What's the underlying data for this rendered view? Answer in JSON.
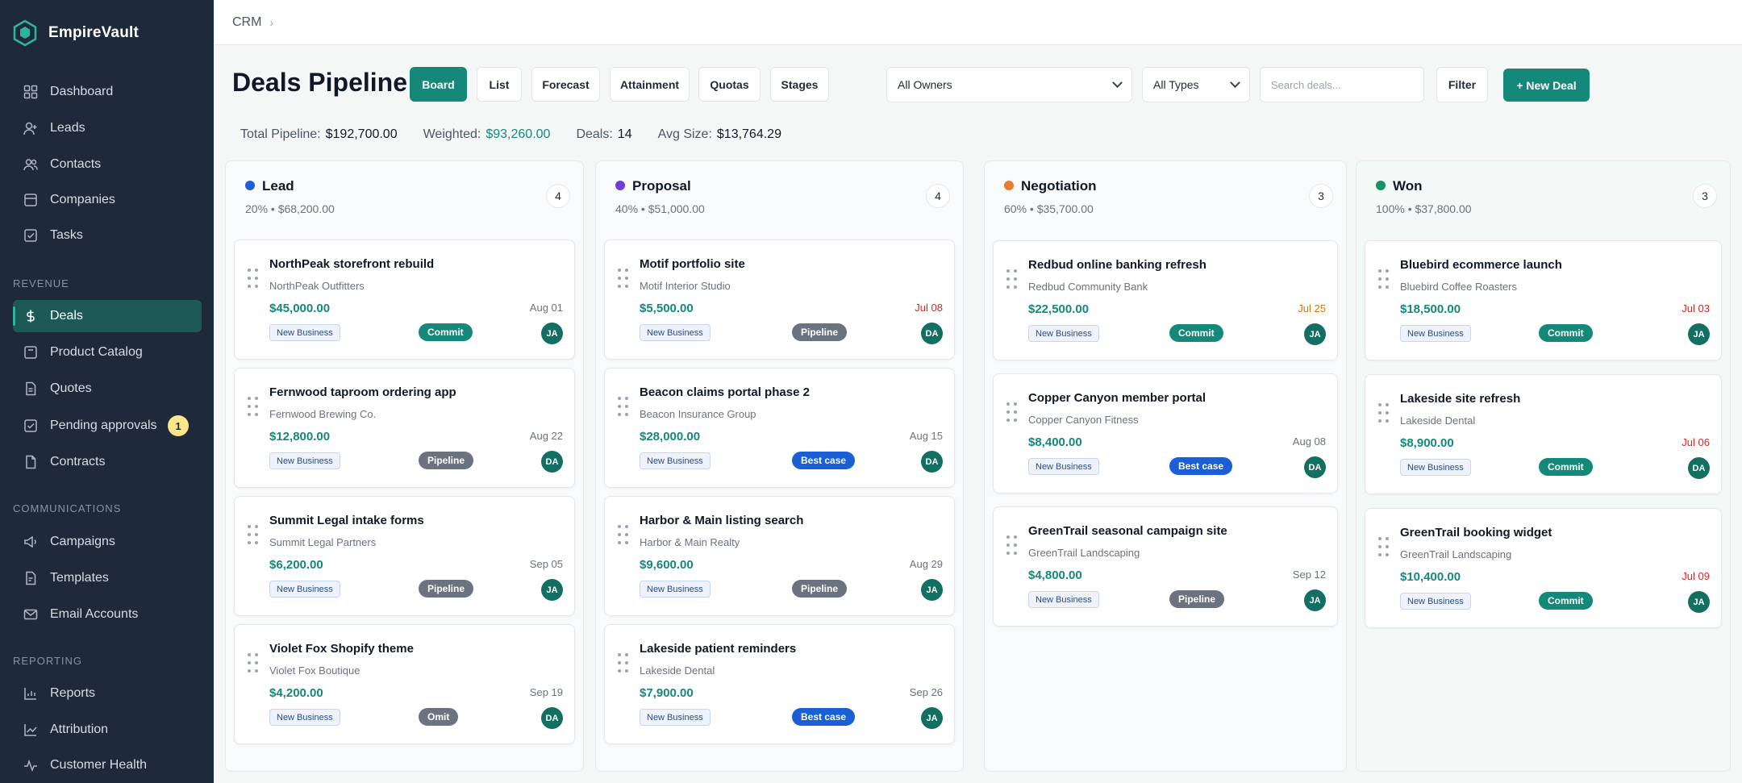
{
  "brand": {
    "name": "EmpireVault"
  },
  "breadcrumb": {
    "root": "CRM",
    "sep": "›"
  },
  "sidebar": {
    "items_main": [
      {
        "label": "Dashboard",
        "icon": "grid-icon"
      },
      {
        "label": "Leads",
        "icon": "user-plus-icon"
      },
      {
        "label": "Contacts",
        "icon": "users-icon"
      },
      {
        "label": "Companies",
        "icon": "building-icon"
      },
      {
        "label": "Tasks",
        "icon": "check-square-icon"
      }
    ],
    "section_revenue": "REVENUE",
    "items_revenue": [
      {
        "label": "Deals",
        "icon": "dollar-icon"
      },
      {
        "label": "Product Catalog",
        "icon": "package-icon"
      },
      {
        "label": "Quotes",
        "icon": "document-icon"
      },
      {
        "label": "Pending approvals",
        "icon": "check-square-icon",
        "badge": "1"
      },
      {
        "label": "Contracts",
        "icon": "file-icon"
      }
    ],
    "section_communications": "COMMUNICATIONS",
    "items_communications": [
      {
        "label": "Campaigns",
        "icon": "megaphone-icon"
      },
      {
        "label": "Templates",
        "icon": "template-icon"
      },
      {
        "label": "Email Accounts",
        "icon": "mail-icon"
      }
    ],
    "section_reporting": "REPORTING",
    "items_reporting": [
      {
        "label": "Reports",
        "icon": "report-icon"
      },
      {
        "label": "Attribution",
        "icon": "trend-icon"
      },
      {
        "label": "Customer Health",
        "icon": "pulse-icon"
      }
    ]
  },
  "header": {
    "title": "Deals Pipeline",
    "views": [
      "Board",
      "List",
      "Forecast",
      "Attainment",
      "Quotas",
      "Stages"
    ],
    "owner_select": "All Owners",
    "type_select": "All Types",
    "search_placeholder": "Search deals...",
    "filter_label": "Filter",
    "new_deal_label": "+ New Deal"
  },
  "stats": {
    "total_label": "Total Pipeline:",
    "total_value": "$192,700.00",
    "weighted_label": "Weighted:",
    "weighted_value": "$93,260.00",
    "deals_label": "Deals:",
    "deals_value": "14",
    "avg_label": "Avg Size:",
    "avg_value": "$13,764.29"
  },
  "colors": {
    "accent": "#14897a",
    "lead": "#1f5fd6",
    "proposal": "#6d3fd6",
    "negotiation": "#ea7b2a",
    "won": "#18935d"
  },
  "columns": [
    {
      "name": "Lead",
      "meta": "20%  •  $68,200.00",
      "count": "4",
      "cards": [
        {
          "title": "NorthPeak storefront rebuild",
          "company": "NorthPeak Outfitters",
          "amount": "$45,000.00",
          "date": "Aug 01",
          "tag": "New Business",
          "forecast": "Commit",
          "owner": "JA"
        },
        {
          "title": "Fernwood taproom ordering app",
          "company": "Fernwood Brewing Co.",
          "amount": "$12,800.00",
          "date": "Aug 22",
          "tag": "New Business",
          "forecast": "Pipeline",
          "owner": "DA"
        },
        {
          "title": "Summit Legal intake forms",
          "company": "Summit Legal Partners",
          "amount": "$6,200.00",
          "date": "Sep 05",
          "tag": "New Business",
          "forecast": "Pipeline",
          "owner": "JA"
        },
        {
          "title": "Violet Fox Shopify theme",
          "company": "Violet Fox Boutique",
          "amount": "$4,200.00",
          "date": "Sep 19",
          "tag": "New Business",
          "forecast": "Omit",
          "owner": "DA"
        }
      ]
    },
    {
      "name": "Proposal",
      "meta": "40%  •  $51,000.00",
      "count": "4",
      "cards": [
        {
          "title": "Motif portfolio site",
          "company": "Motif Interior Studio",
          "amount": "$5,500.00",
          "date": "Jul 08",
          "tag": "New Business",
          "forecast": "Pipeline",
          "owner": "DA"
        },
        {
          "title": "Beacon claims portal phase 2",
          "company": "Beacon Insurance Group",
          "amount": "$28,000.00",
          "date": "Aug 15",
          "tag": "New Business",
          "forecast": "Best case",
          "owner": "DA"
        },
        {
          "title": "Harbor & Main listing search",
          "company": "Harbor & Main Realty",
          "amount": "$9,600.00",
          "date": "Aug 29",
          "tag": "New Business",
          "forecast": "Pipeline",
          "owner": "JA"
        },
        {
          "title": "Lakeside patient reminders",
          "company": "Lakeside Dental",
          "amount": "$7,900.00",
          "date": "Sep 26",
          "tag": "New Business",
          "forecast": "Best case",
          "owner": "JA"
        }
      ]
    },
    {
      "name": "Negotiation",
      "meta": "60%  •  $35,700.00",
      "count": "3",
      "cards": [
        {
          "title": "Redbud online banking refresh",
          "company": "Redbud Community Bank",
          "amount": "$22,500.00",
          "date": "Jul 25",
          "tag": "New Business",
          "forecast": "Commit",
          "owner": "JA"
        },
        {
          "title": "Copper Canyon member portal",
          "company": "Copper Canyon Fitness",
          "amount": "$8,400.00",
          "date": "Aug 08",
          "tag": "New Business",
          "forecast": "Best case",
          "owner": "DA"
        },
        {
          "title": "GreenTrail seasonal campaign site",
          "company": "GreenTrail Landscaping",
          "amount": "$4,800.00",
          "date": "Sep 12",
          "tag": "New Business",
          "forecast": "Pipeline",
          "owner": "JA"
        }
      ]
    },
    {
      "name": "Won",
      "meta": "100%  •  $37,800.00",
      "count": "3",
      "cards": [
        {
          "title": "Bluebird ecommerce launch",
          "company": "Bluebird Coffee Roasters",
          "amount": "$18,500.00",
          "date": "Jul 03",
          "tag": "New Business",
          "forecast": "Commit",
          "owner": "JA"
        },
        {
          "title": "Lakeside site refresh",
          "company": "Lakeside Dental",
          "amount": "$8,900.00",
          "date": "Jul 06",
          "tag": "New Business",
          "forecast": "Commit",
          "owner": "DA"
        },
        {
          "title": "GreenTrail booking widget",
          "company": "GreenTrail Landscaping",
          "amount": "$10,400.00",
          "date": "Jul 09",
          "tag": "New Business",
          "forecast": "Commit",
          "owner": "JA"
        }
      ]
    }
  ]
}
